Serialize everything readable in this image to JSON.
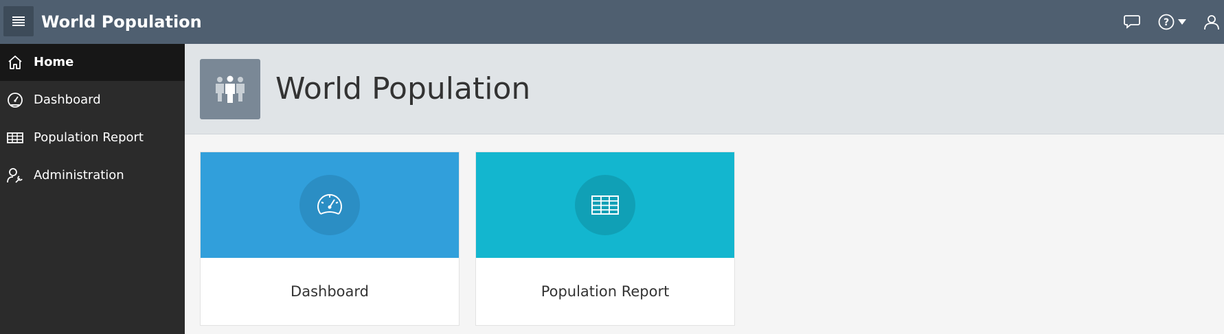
{
  "header": {
    "app_title": "World Population",
    "icons": [
      "menu-icon",
      "chat-icon",
      "help-icon",
      "caret-down-icon",
      "user-icon"
    ]
  },
  "sidebar": {
    "items": [
      {
        "label": "Home",
        "icon": "home-icon",
        "active": true
      },
      {
        "label": "Dashboard",
        "icon": "dashboard-icon",
        "active": false
      },
      {
        "label": "Population Report",
        "icon": "table-icon",
        "active": false
      },
      {
        "label": "Administration",
        "icon": "user-wrench-icon",
        "active": false
      }
    ]
  },
  "hero": {
    "title": "World Population",
    "icon": "people-icon"
  },
  "cards": [
    {
      "label": "Dashboard",
      "icon": "dashboard-icon",
      "color": "#319fdb",
      "circle_color": "#2b8ec4"
    },
    {
      "label": "Population Report",
      "icon": "table-icon",
      "color": "#13b6cf",
      "circle_color": "#10a0b6"
    }
  ],
  "colors": {
    "header": "#4f5f70",
    "sidebar": "#2b2b2b",
    "sidebar_active": "#171717",
    "hero": "#e0e4e7",
    "body": "#f5f5f5"
  }
}
